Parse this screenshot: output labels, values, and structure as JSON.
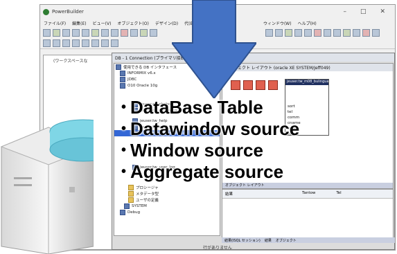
{
  "window": {
    "title": "PowerBuilder",
    "menu": [
      "ファイル(F)",
      "編集(E)",
      "ビュー(V)",
      "オブジェクト(O)",
      "デザイン(D)",
      "代(B)",
      "ウィンドウ(W)",
      "ヘルプ(H)"
    ],
    "controls": {
      "minimize": "–",
      "maximize": "□",
      "close": "✕"
    }
  },
  "workspace": {
    "label": "(ワークスペースな"
  },
  "db_painter": {
    "title": "DB - 1 Connection (プライマリ接続: Oracle XE SYSTEM/Jeff049)",
    "tree": [
      {
        "label": "使用できる DB インタフェース",
        "kind": "db"
      },
      {
        "label": "INFORMIX v6.x",
        "kind": "db"
      },
      {
        "label": "JDBC",
        "kind": "db"
      },
      {
        "label": "O10 Oracle 10g",
        "kind": "db"
      },
      {
        "label": "jeuser.ch_chobo",
        "kind": "table"
      },
      {
        "label": "jeuser.ch_chobo_count",
        "kind": "table"
      },
      {
        "label": "jeuser.tw_help",
        "kind": "table"
      },
      {
        "label": "jeuser.tw_m08_cntrl",
        "kind": "table"
      },
      {
        "label": "jeuser.tw_m08_bulingual",
        "kind": "table"
      },
      {
        "label": "jeuser.tw_user_log",
        "kind": "table"
      },
      {
        "label": "プロシージャ",
        "kind": "folder"
      },
      {
        "label": "メタデータ型",
        "kind": "folder"
      },
      {
        "label": "ユーザの定義",
        "kind": "folder"
      },
      {
        "label": "SYSTEM",
        "kind": "db"
      },
      {
        "label": "Debug",
        "kind": "db"
      }
    ]
  },
  "layout_pane": {
    "title": "オブジェクト レイアウト (oracle XE SYSTEM/Jeff049)",
    "table_name": "jeuser.tw_m08_bulingual",
    "columns": [
      "sort",
      "tel",
      "comm",
      "cname",
      "syskt",
      "sysed"
    ],
    "tab": "オブジェクト レイアウト"
  },
  "result_pane": {
    "title": "結果",
    "columns": [
      "Tantow",
      "Tel"
    ],
    "tabs": [
      "結果(ISQL セッション)",
      "結果",
      "オブジェクト"
    ]
  },
  "status_text": "行がありません",
  "bullets": [
    "DataBase Table",
    "Datawindow source",
    "Window source",
    "Aggregate source"
  ],
  "colors": {
    "arrow": "#4472c4",
    "server_accent": "#7fd6e6",
    "selection": "#3367d6"
  }
}
